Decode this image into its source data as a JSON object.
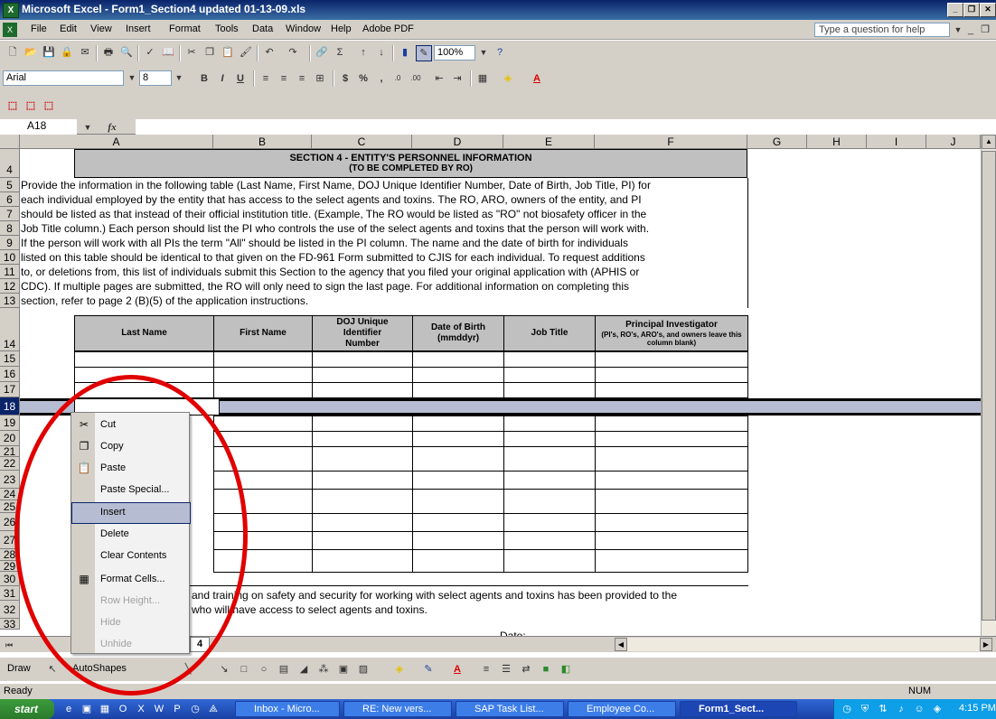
{
  "window": {
    "title": "Microsoft Excel - Form1_Section4 updated 01-13-09.xls",
    "app_icon": "excel-icon"
  },
  "menu": {
    "items": [
      "File",
      "Edit",
      "View",
      "Insert",
      "Format",
      "Tools",
      "Data",
      "Window",
      "Help",
      "Adobe PDF"
    ],
    "help_placeholder": "Type a question for help"
  },
  "formatting": {
    "font": "Arial",
    "size": "8",
    "zoom": "100%"
  },
  "formula_bar": {
    "name_box": "A18",
    "fx": "fx"
  },
  "columns": [
    "A",
    "B",
    "C",
    "D",
    "E",
    "F",
    "G",
    "H",
    "I",
    "J"
  ],
  "rows": [
    "4",
    "5",
    "6",
    "7",
    "8",
    "9",
    "10",
    "11",
    "12",
    "13",
    "14",
    "15",
    "16",
    "17",
    "18",
    "19",
    "20",
    "21",
    "22",
    "23",
    "24",
    "25",
    "26",
    "27",
    "28",
    "29",
    "30",
    "31",
    "32",
    "33"
  ],
  "section": {
    "title": "SECTION 4 - ENTITY'S PERSONNEL INFORMATION",
    "subtitle": "(TO BE COMPLETED BY RO)"
  },
  "instructions": [
    "Provide the information in the following table (Last Name, First Name, DOJ Unique Identifier Number, Date of Birth, Job Title, PI) for",
    "each individual employed by the entity that has access to the select agents and toxins. The RO, ARO, owners of the entity, and PI",
    "should be listed as that instead of their official institution title. (Example, The RO would be listed as \"RO\" not biosafety officer in the",
    "Job Title column.) Each person should list the PI who controls the use of the select agents and toxins that the person will work with.",
    "If the person will work with all PIs the term \"All\" should be listed in the PI column. The name and the date of birth for individuals",
    " listed on this table should be identical to that given on the FD-961 Form submitted to CJIS for each individual. To request additions",
    "to, or deletions from, this list of individuals submit this Section to the agency that you filed your original application with (APHIS or",
    "CDC). If multiple pages are submitted, the RO will only need to sign the last page. For additional information on completing this",
    "section, refer to page 2 (B)(5) of the application instructions."
  ],
  "table_headers": [
    "Last Name",
    "First Name",
    "DOJ Unique Identifier Number",
    "Date of Birth (mmddyr)",
    "Job Title",
    "Principal Investigator"
  ],
  "pi_note": "(PI's, RO's, ARO's, and owners leave this column blank)",
  "footer_text": {
    "line1": "and training on safety and security for working with select agents and toxins has been provided to the",
    "line2": "who will have access to select agents and toxins.",
    "date_label": "Date:"
  },
  "context_menu": [
    {
      "label": "Cut",
      "icon": "scissors-icon",
      "glyph": "✂",
      "enabled": true
    },
    {
      "label": "Copy",
      "icon": "copy-icon",
      "glyph": "❐",
      "enabled": true
    },
    {
      "label": "Paste",
      "icon": "paste-icon",
      "glyph": "📋",
      "enabled": true
    },
    {
      "label": "Paste Special...",
      "icon": "",
      "glyph": "",
      "enabled": true
    },
    {
      "label": "Insert",
      "icon": "",
      "glyph": "",
      "enabled": true,
      "selected": true
    },
    {
      "label": "Delete",
      "icon": "",
      "glyph": "",
      "enabled": true
    },
    {
      "label": "Clear Contents",
      "icon": "",
      "glyph": "",
      "enabled": true
    },
    {
      "label": "Format Cells...",
      "icon": "format-cells-icon",
      "glyph": "▦",
      "enabled": true
    },
    {
      "label": "Row Height...",
      "icon": "",
      "glyph": "",
      "enabled": false
    },
    {
      "label": "Hide",
      "icon": "",
      "glyph": "",
      "enabled": false
    },
    {
      "label": "Unhide",
      "icon": "",
      "glyph": "",
      "enabled": false
    }
  ],
  "sheet_tab": {
    "label": "4"
  },
  "draw_bar": {
    "draw": "Draw",
    "autoshapes": "AutoShapes"
  },
  "status": {
    "left": "Ready",
    "num": "NUM"
  },
  "taskbar": {
    "start": "start",
    "items": [
      "Inbox - Micro...",
      "RE: New vers...",
      "SAP Task List...",
      "Employee Co...",
      "Form1_Sect..."
    ],
    "clock": "4:15 PM"
  },
  "colors": {
    "accent_circle": "#e00000",
    "selected_row": "#b6bdd2"
  }
}
